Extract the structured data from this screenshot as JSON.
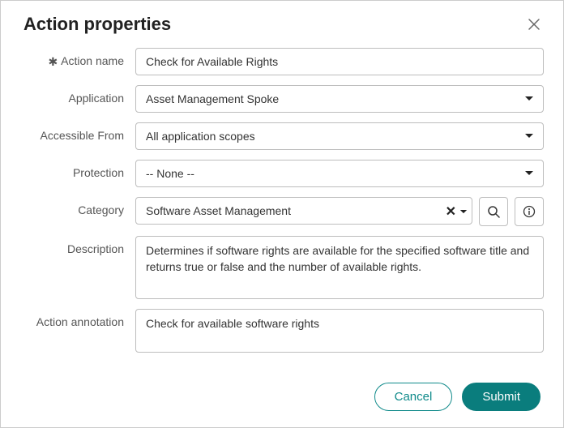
{
  "dialog": {
    "title": "Action properties",
    "labels": {
      "action_name": "Action name",
      "application": "Application",
      "accessible_from": "Accessible From",
      "protection": "Protection",
      "category": "Category",
      "description": "Description",
      "action_annotation": "Action annotation"
    },
    "fields": {
      "action_name": "Check for Available Rights",
      "application": "Asset Management Spoke",
      "accessible_from": "All application scopes",
      "protection": "-- None --",
      "category": "Software Asset Management",
      "description": "Determines if software rights are available for the specified software title and returns true or false and the number of available rights.",
      "action_annotation": "Check for available software rights"
    },
    "footer": {
      "cancel": "Cancel",
      "submit": "Submit"
    }
  }
}
